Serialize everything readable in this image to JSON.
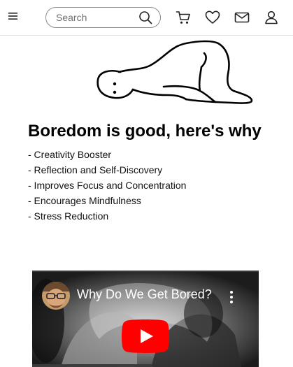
{
  "header": {
    "search_placeholder": "Search",
    "icons": [
      "menu-icon",
      "search-icon",
      "cart-icon",
      "heart-icon",
      "mail-icon",
      "user-icon"
    ]
  },
  "article": {
    "title": "Boredom is good, here's why",
    "benefits": [
      "- Creativity Booster",
      "- Reflection and Self-Discovery",
      "- Improves Focus and Concentration",
      "- Encourages Mindfulness",
      "- Stress Reduction"
    ]
  },
  "video": {
    "title": "Why Do We Get Bored?",
    "play_button_color": "#ff0000"
  }
}
